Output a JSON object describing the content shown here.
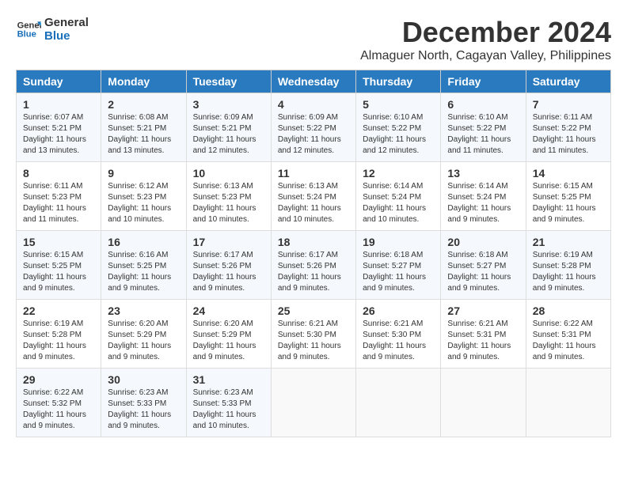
{
  "logo": {
    "line1": "General",
    "line2": "Blue"
  },
  "title": "December 2024",
  "location": "Almaguer North, Cagayan Valley, Philippines",
  "days_of_week": [
    "Sunday",
    "Monday",
    "Tuesday",
    "Wednesday",
    "Thursday",
    "Friday",
    "Saturday"
  ],
  "weeks": [
    [
      {
        "day": "1",
        "info": "Sunrise: 6:07 AM\nSunset: 5:21 PM\nDaylight: 11 hours\nand 13 minutes."
      },
      {
        "day": "2",
        "info": "Sunrise: 6:08 AM\nSunset: 5:21 PM\nDaylight: 11 hours\nand 13 minutes."
      },
      {
        "day": "3",
        "info": "Sunrise: 6:09 AM\nSunset: 5:21 PM\nDaylight: 11 hours\nand 12 minutes."
      },
      {
        "day": "4",
        "info": "Sunrise: 6:09 AM\nSunset: 5:22 PM\nDaylight: 11 hours\nand 12 minutes."
      },
      {
        "day": "5",
        "info": "Sunrise: 6:10 AM\nSunset: 5:22 PM\nDaylight: 11 hours\nand 12 minutes."
      },
      {
        "day": "6",
        "info": "Sunrise: 6:10 AM\nSunset: 5:22 PM\nDaylight: 11 hours\nand 11 minutes."
      },
      {
        "day": "7",
        "info": "Sunrise: 6:11 AM\nSunset: 5:22 PM\nDaylight: 11 hours\nand 11 minutes."
      }
    ],
    [
      {
        "day": "8",
        "info": "Sunrise: 6:11 AM\nSunset: 5:23 PM\nDaylight: 11 hours\nand 11 minutes."
      },
      {
        "day": "9",
        "info": "Sunrise: 6:12 AM\nSunset: 5:23 PM\nDaylight: 11 hours\nand 10 minutes."
      },
      {
        "day": "10",
        "info": "Sunrise: 6:13 AM\nSunset: 5:23 PM\nDaylight: 11 hours\nand 10 minutes."
      },
      {
        "day": "11",
        "info": "Sunrise: 6:13 AM\nSunset: 5:24 PM\nDaylight: 11 hours\nand 10 minutes."
      },
      {
        "day": "12",
        "info": "Sunrise: 6:14 AM\nSunset: 5:24 PM\nDaylight: 11 hours\nand 10 minutes."
      },
      {
        "day": "13",
        "info": "Sunrise: 6:14 AM\nSunset: 5:24 PM\nDaylight: 11 hours\nand 9 minutes."
      },
      {
        "day": "14",
        "info": "Sunrise: 6:15 AM\nSunset: 5:25 PM\nDaylight: 11 hours\nand 9 minutes."
      }
    ],
    [
      {
        "day": "15",
        "info": "Sunrise: 6:15 AM\nSunset: 5:25 PM\nDaylight: 11 hours\nand 9 minutes."
      },
      {
        "day": "16",
        "info": "Sunrise: 6:16 AM\nSunset: 5:25 PM\nDaylight: 11 hours\nand 9 minutes."
      },
      {
        "day": "17",
        "info": "Sunrise: 6:17 AM\nSunset: 5:26 PM\nDaylight: 11 hours\nand 9 minutes."
      },
      {
        "day": "18",
        "info": "Sunrise: 6:17 AM\nSunset: 5:26 PM\nDaylight: 11 hours\nand 9 minutes."
      },
      {
        "day": "19",
        "info": "Sunrise: 6:18 AM\nSunset: 5:27 PM\nDaylight: 11 hours\nand 9 minutes."
      },
      {
        "day": "20",
        "info": "Sunrise: 6:18 AM\nSunset: 5:27 PM\nDaylight: 11 hours\nand 9 minutes."
      },
      {
        "day": "21",
        "info": "Sunrise: 6:19 AM\nSunset: 5:28 PM\nDaylight: 11 hours\nand 9 minutes."
      }
    ],
    [
      {
        "day": "22",
        "info": "Sunrise: 6:19 AM\nSunset: 5:28 PM\nDaylight: 11 hours\nand 9 minutes."
      },
      {
        "day": "23",
        "info": "Sunrise: 6:20 AM\nSunset: 5:29 PM\nDaylight: 11 hours\nand 9 minutes."
      },
      {
        "day": "24",
        "info": "Sunrise: 6:20 AM\nSunset: 5:29 PM\nDaylight: 11 hours\nand 9 minutes."
      },
      {
        "day": "25",
        "info": "Sunrise: 6:21 AM\nSunset: 5:30 PM\nDaylight: 11 hours\nand 9 minutes."
      },
      {
        "day": "26",
        "info": "Sunrise: 6:21 AM\nSunset: 5:30 PM\nDaylight: 11 hours\nand 9 minutes."
      },
      {
        "day": "27",
        "info": "Sunrise: 6:21 AM\nSunset: 5:31 PM\nDaylight: 11 hours\nand 9 minutes."
      },
      {
        "day": "28",
        "info": "Sunrise: 6:22 AM\nSunset: 5:31 PM\nDaylight: 11 hours\nand 9 minutes."
      }
    ],
    [
      {
        "day": "29",
        "info": "Sunrise: 6:22 AM\nSunset: 5:32 PM\nDaylight: 11 hours\nand 9 minutes."
      },
      {
        "day": "30",
        "info": "Sunrise: 6:23 AM\nSunset: 5:33 PM\nDaylight: 11 hours\nand 9 minutes."
      },
      {
        "day": "31",
        "info": "Sunrise: 6:23 AM\nSunset: 5:33 PM\nDaylight: 11 hours\nand 10 minutes."
      },
      {
        "day": "",
        "info": ""
      },
      {
        "day": "",
        "info": ""
      },
      {
        "day": "",
        "info": ""
      },
      {
        "day": "",
        "info": ""
      }
    ]
  ]
}
